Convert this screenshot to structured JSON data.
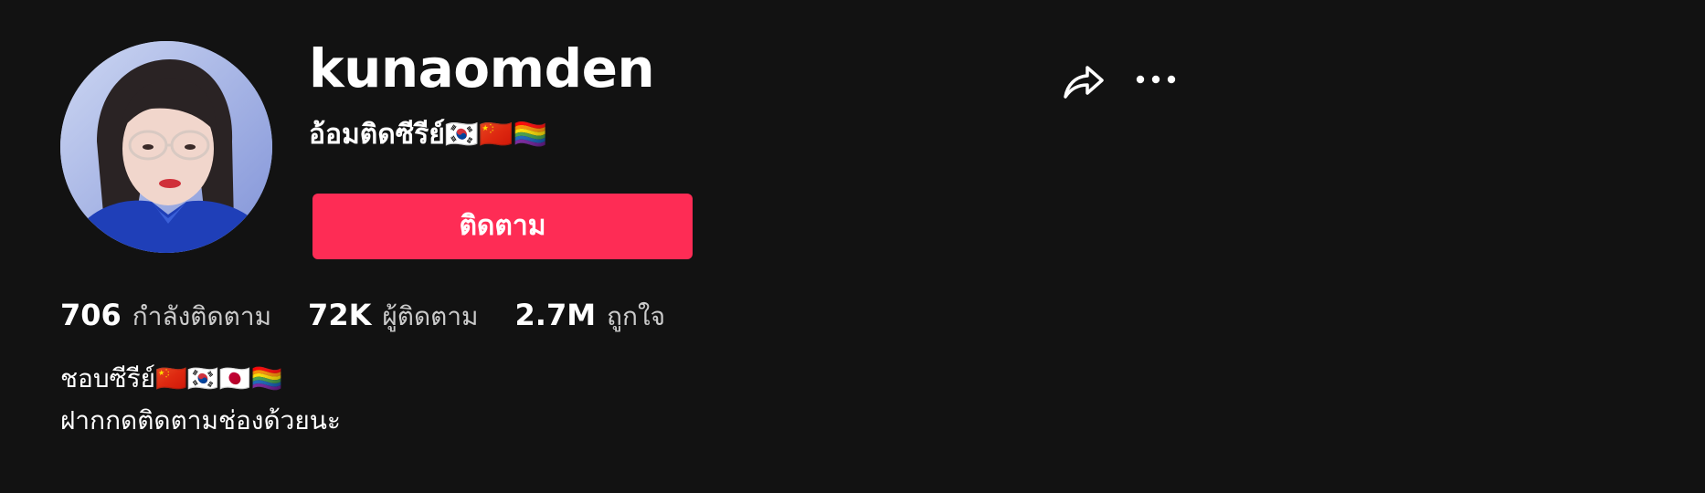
{
  "profile": {
    "username": "kunaomden",
    "nickname": "อ้อมติดซีรีย์🇰🇷🇨🇳🏳️‍🌈",
    "follow_label": "ติดตาม",
    "stats": [
      {
        "value": "706",
        "label": "กำลังติดตาม"
      },
      {
        "value": "72K",
        "label": "ผู้ติดตาม"
      },
      {
        "value": "2.7M",
        "label": "ถูกใจ"
      }
    ],
    "bio": [
      "ชอบซีรีย์🇨🇳🇰🇷🇯🇵🏳️‍🌈",
      "ฝากกดติดตามช่องด้วยนะ"
    ]
  },
  "icons": {
    "share": "share-icon",
    "more": "more-icon"
  },
  "colors": {
    "background": "#121212",
    "follow_button": "#fe2c55",
    "text": "#ffffff"
  }
}
